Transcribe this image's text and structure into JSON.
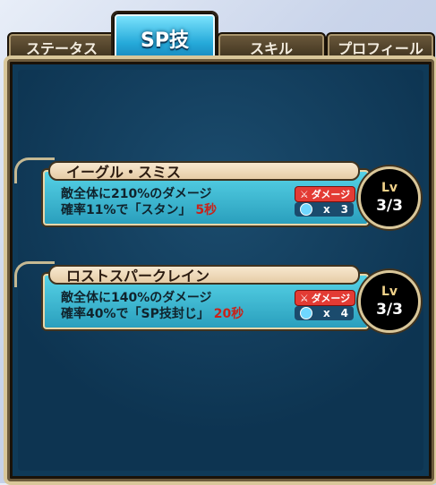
{
  "tabs": [
    {
      "label": "ステータス"
    },
    {
      "label": "SP技",
      "active": true
    },
    {
      "label": "スキル"
    },
    {
      "label": "プロフィール"
    }
  ],
  "skills": [
    {
      "name": "イーグル・スミス",
      "line1": "敵全体に210%のダメージ",
      "line2_prefix": "確率11%で「スタン」",
      "line2_secs": "5秒",
      "damage_label": "ダメージ",
      "cost_x": "x",
      "cost_value": "3",
      "lv_label": "Lv",
      "lv_value": "3/3"
    },
    {
      "name": "ロストスパークレイン",
      "line1": "敵全体に140%のダメージ",
      "line2_prefix": "確率40%で「SP技封じ」",
      "line2_secs": "20秒",
      "damage_label": "ダメージ",
      "cost_x": "x",
      "cost_value": "4",
      "lv_label": "Lv",
      "lv_value": "3/3"
    }
  ]
}
